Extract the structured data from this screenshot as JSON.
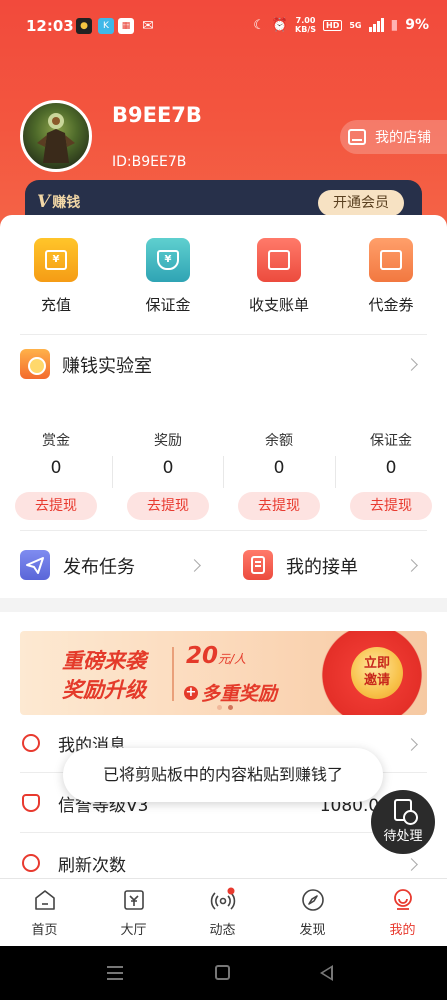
{
  "status_bar": {
    "time": "12:03",
    "net_speed_value": "7.00",
    "net_speed_unit": "KB/S",
    "hd_badge": "HD",
    "signal_label": "5G",
    "battery": "9%"
  },
  "profile": {
    "username": "B9EE7B",
    "user_id": "ID:B9EE7B",
    "shop_button": "我的店铺"
  },
  "vip": {
    "logo_letter": "V",
    "logo_text": "赚钱",
    "open_button": "开通会员"
  },
  "quick_actions": [
    {
      "label": "充值",
      "icon": "recharge-icon",
      "glyph": "¥",
      "color_top": "#ffc52a",
      "color_bottom": "#f59c15"
    },
    {
      "label": "保证金",
      "icon": "deposit-shield-icon",
      "glyph": "¥",
      "color_top": "#5fd0cf",
      "color_bottom": "#2fa4b4"
    },
    {
      "label": "收支账单",
      "icon": "wallet-icon",
      "glyph": "",
      "color_top": "#ff7a6a",
      "color_bottom": "#ec4b3e"
    },
    {
      "label": "代金券",
      "icon": "voucher-icon",
      "glyph": "",
      "color_top": "#ff9f6a",
      "color_bottom": "#f27840"
    }
  ],
  "lab": {
    "label": "赚钱实验室"
  },
  "stats": [
    {
      "label": "赏金",
      "value": "0",
      "button": "去提现"
    },
    {
      "label": "奖励",
      "value": "0",
      "button": "去提现"
    },
    {
      "label": "余额",
      "value": "0",
      "button": "去提现"
    },
    {
      "label": "保证金",
      "value": "0",
      "button": "去提现"
    }
  ],
  "tasks": {
    "publish_label": "发布任务",
    "orders_label": "我的接单"
  },
  "banner": {
    "line1": "重磅来袭",
    "line2": "奖励升级",
    "amount": "20",
    "amount_unit": "元/人",
    "plus_text": "多重奖励",
    "go_line1": "立即",
    "go_line2": "邀请"
  },
  "list": {
    "messages_label": "我的消息",
    "credit_label": "信誉等级V3",
    "credit_value": "1080.00分",
    "refresh_label": "刷新次数"
  },
  "toast": "已将剪贴板中的内容粘贴到赚钱了",
  "pending_label": "待处理",
  "tabbar": [
    {
      "label": "首页",
      "icon": "home-icon"
    },
    {
      "label": "大厅",
      "icon": "hall-icon"
    },
    {
      "label": "动态",
      "icon": "broadcast-icon"
    },
    {
      "label": "发现",
      "icon": "compass-icon"
    },
    {
      "label": "我的",
      "icon": "profile-icon",
      "active": true
    }
  ],
  "colors": {
    "brand_red": "#e83a2f",
    "header_red": "#f24a3c",
    "vip_bar": "#27304a",
    "vip_gold": "#f2d7a6"
  }
}
